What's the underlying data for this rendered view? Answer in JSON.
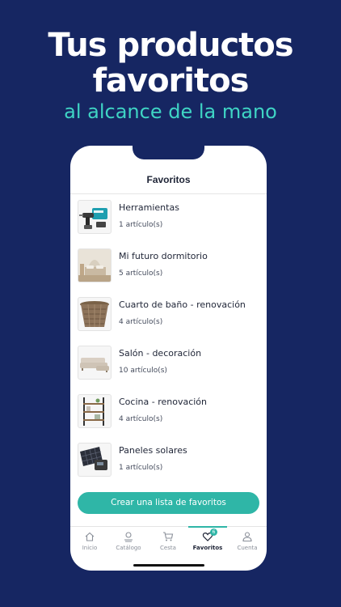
{
  "promo": {
    "title_line1": "Tus productos",
    "title_line2": "favoritos",
    "subtitle": "al alcance de la mano"
  },
  "header": {
    "title": "Favoritos"
  },
  "lists": [
    {
      "title": "Herramientas",
      "count": "1 artículo(s)",
      "icon": "drill-image"
    },
    {
      "title": "Mi futuro dormitorio",
      "count": "5 artículo(s)",
      "icon": "bedroom-image"
    },
    {
      "title": "Cuarto de baño - renovación",
      "count": "4 artículo(s)",
      "icon": "basket-image"
    },
    {
      "title": "Salón - decoración",
      "count": "10 artículo(s)",
      "icon": "sofa-image"
    },
    {
      "title": "Cocina - renovación",
      "count": "4 artículo(s)",
      "icon": "shelf-image"
    },
    {
      "title": "Paneles solares",
      "count": "1 artículo(s)",
      "icon": "solar-panel-image"
    }
  ],
  "create_button": "Crear una lista de favoritos",
  "tabs": [
    {
      "label": "Inicio",
      "icon": "home-icon"
    },
    {
      "label": "Catálogo",
      "icon": "catalog-icon"
    },
    {
      "label": "Cesta",
      "icon": "cart-icon"
    },
    {
      "label": "Favoritos",
      "icon": "heart-icon",
      "badge": "6",
      "active": true
    },
    {
      "label": "Cuenta",
      "icon": "account-icon"
    }
  ],
  "colors": {
    "background": "#162662",
    "accent": "#2fb6a7",
    "subtitle": "#3fd4c4"
  }
}
